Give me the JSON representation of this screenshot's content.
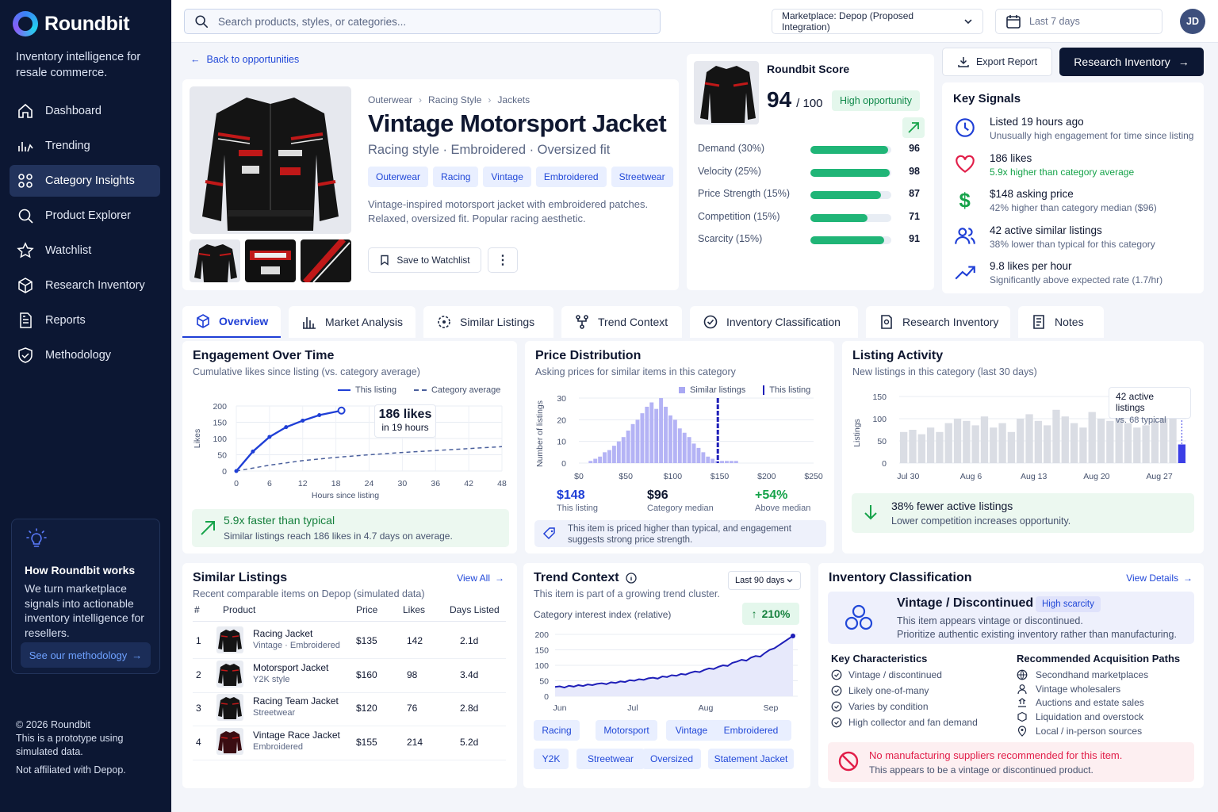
{
  "app": {
    "name": "Roundbit",
    "tagline": "Inventory intelligence for resale commerce."
  },
  "nav": [
    {
      "label": "Dashboard",
      "icon": "home-icon"
    },
    {
      "label": "Trending",
      "icon": "trending-icon"
    },
    {
      "label": "Category Insights",
      "icon": "category-icon",
      "active": true
    },
    {
      "label": "Product Explorer",
      "icon": "search-icon"
    },
    {
      "label": "Watchlist",
      "icon": "star-icon"
    },
    {
      "label": "Research Inventory",
      "icon": "cube-icon"
    },
    {
      "label": "Reports",
      "icon": "report-icon"
    },
    {
      "label": "Methodology",
      "icon": "shield-check-icon"
    }
  ],
  "how": {
    "title": "How Roundbit works",
    "text": "We turn marketplace signals into actionable inventory intelligence for resellers.",
    "button": "See our methodology"
  },
  "footer": {
    "copyright": "© 2026 Roundbit",
    "note": "This is a prototype using simulated data.",
    "disclaimer": "Not affiliated with Depop."
  },
  "top": {
    "search_placeholder": "Search products, styles, or categories...",
    "marketplace": "Marketplace: Depop (Proposed Integration)",
    "date_range": "Last 7 days",
    "avatar": "JD"
  },
  "back": "Back to opportunities",
  "product": {
    "breadcrumbs": [
      "Outerwear",
      "Racing Style",
      "Jackets"
    ],
    "title": "Vintage Motorsport Jacket",
    "subtitle": "Racing style · Embroidered · Oversized fit",
    "tags": [
      "Outerwear",
      "Racing",
      "Vintage",
      "Embroidered",
      "Streetwear"
    ],
    "description": "Vintage-inspired motorsport jacket with embroidered patches. Relaxed, oversized fit. Popular racing aesthetic.",
    "save_label": "Save to Watchlist"
  },
  "score": {
    "title": "Roundbit Score",
    "value": "94",
    "max": "/ 100",
    "badge": "High opportunity",
    "rows": [
      {
        "label": "Demand (30%)",
        "value": 96
      },
      {
        "label": "Velocity (25%)",
        "value": 98
      },
      {
        "label": "Price Strength (15%)",
        "value": 87
      },
      {
        "label": "Competition (15%)",
        "value": 71
      },
      {
        "label": "Scarcity (15%)",
        "value": 91
      }
    ]
  },
  "actions": {
    "export": "Export Report",
    "research": "Research Inventory"
  },
  "signals": {
    "title": "Key Signals",
    "items": [
      {
        "icon": "clock-icon",
        "title": "Listed 19 hours ago",
        "detail": "Unusually high engagement for time since listing",
        "color": "#1f3fd6",
        "detail_color": "#5b6784"
      },
      {
        "icon": "heart-icon",
        "title": "186 likes",
        "detail": "5.9x higher than category average",
        "color": "#e11d48",
        "detail_color": "#16a34a"
      },
      {
        "icon": "dollar-icon",
        "title": "$148 asking price",
        "detail": "42% higher than category median ($96)",
        "color": "#16a34a",
        "detail_color": "#5b6784"
      },
      {
        "icon": "users-icon",
        "title": "42 active similar listings",
        "detail": "38% lower than typical for this category",
        "color": "#1f3fd6",
        "detail_color": "#5b6784"
      },
      {
        "icon": "trend-up-icon",
        "title": "9.8 likes per hour",
        "detail": "Significantly above expected rate (1.7/hr)",
        "color": "#1f3fd6",
        "detail_color": "#5b6784"
      }
    ]
  },
  "tabs": [
    {
      "label": "Overview",
      "icon": "cube-icon"
    },
    {
      "label": "Market Analysis",
      "icon": "bar-chart-icon"
    },
    {
      "label": "Similar Listings",
      "icon": "target-icon"
    },
    {
      "label": "Trend Context",
      "icon": "network-icon"
    },
    {
      "label": "Inventory Classification",
      "icon": "check-badge-icon"
    },
    {
      "label": "Research Inventory",
      "icon": "research-icon"
    },
    {
      "label": "Notes",
      "icon": "notes-icon"
    }
  ],
  "engagement": {
    "title": "Engagement Over Time",
    "subtitle": "Cumulative likes since listing (vs. category average)",
    "legend": [
      "This listing",
      "Category average"
    ],
    "callout_big": "186 likes",
    "callout_small": "in 19 hours",
    "xlabel": "Hours since listing",
    "ylabel": "Likes",
    "insight_title": "5.9x faster than typical",
    "insight_text": "Similar listings reach 186 likes in 4.7 days on average."
  },
  "price": {
    "title": "Price Distribution",
    "subtitle": "Asking prices for similar items in this category",
    "legend": [
      "Similar listings",
      "This listing"
    ],
    "ylabel": "Number of listings",
    "stats": [
      {
        "value": "$148",
        "label": "This listing",
        "color": "#1f3fd6"
      },
      {
        "value": "$96",
        "label": "Category median",
        "color": "#0f1730"
      },
      {
        "value": "+54%",
        "label": "Above median",
        "color": "#16a34a"
      }
    ],
    "note": "This item is priced higher than typical, and engagement suggests strong price strength."
  },
  "activity": {
    "title": "Listing Activity",
    "subtitle": "New listings in this category (last 30 days)",
    "ylabel": "Listings",
    "callout_big": "42 active listings",
    "callout_small": "vs. 68 typical",
    "insight_title": "38% fewer active listings",
    "insight_text": "Lower competition increases opportunity."
  },
  "similar": {
    "title": "Similar Listings",
    "subtitle": "Recent comparable items on Depop (simulated data)",
    "view_all": "View All",
    "headers": [
      "#",
      "Product",
      "Price",
      "Likes",
      "Days Listed"
    ],
    "rows": [
      {
        "n": "1",
        "name": "Racing Jacket",
        "sub": "Vintage · Embroidered",
        "price": "$135",
        "likes": "142",
        "days": "2.1d"
      },
      {
        "n": "2",
        "name": "Motorsport Jacket",
        "sub": "Y2K style",
        "price": "$160",
        "likes": "98",
        "days": "3.4d"
      },
      {
        "n": "3",
        "name": "Racing Team Jacket",
        "sub": "Streetwear",
        "price": "$120",
        "likes": "76",
        "days": "2.8d"
      },
      {
        "n": "4",
        "name": "Vintage Race Jacket",
        "sub": "Embroidered",
        "price": "$155",
        "likes": "214",
        "days": "5.2d"
      }
    ]
  },
  "trend": {
    "title": "Trend Context",
    "subtitle": "This item is part of a growing trend cluster.",
    "range": "Last 90 days",
    "metric": "Category interest index (relative)",
    "change": "210%",
    "tags": [
      "Racing",
      "Motorsport",
      "Vintage",
      "Embroidered",
      "Y2K",
      "Streetwear",
      "Oversized",
      "Statement Jacket"
    ]
  },
  "classification": {
    "title": "Inventory Classification",
    "view": "View Details",
    "heading": "Vintage / Discontinued",
    "badge": "High scarcity",
    "line1": "This item appears vintage or discontinued.",
    "line2": "Prioritize authentic existing inventory rather than manufacturing.",
    "kc_title": "Key Characteristics",
    "kc": [
      "Vintage / discontinued",
      "Likely one-of-many",
      "Varies by condition",
      "High collector and fan demand"
    ],
    "paths_title": "Recommended Acquisition Paths",
    "paths": [
      "Secondhand marketplaces",
      "Vintage wholesalers",
      "Auctions and estate sales",
      "Liquidation and overstock",
      "Local / in-person sources"
    ],
    "warn_title": "No manufacturing suppliers recommended for this item.",
    "warn_text": "This appears to be a vintage or discontinued product."
  },
  "chart_data": [
    {
      "type": "line",
      "title": "Engagement Over Time",
      "xlabel": "Hours since listing",
      "ylabel": "Likes",
      "x_ticks": [
        0,
        6,
        12,
        18,
        24,
        30,
        36,
        42,
        48
      ],
      "y_ticks": [
        0,
        50,
        100,
        150,
        200
      ],
      "ylim": [
        0,
        200
      ],
      "xlim": [
        0,
        48
      ],
      "series": [
        {
          "name": "This listing",
          "x": [
            0,
            3,
            6,
            9,
            12,
            15,
            19
          ],
          "y": [
            0,
            60,
            105,
            135,
            155,
            172,
            186
          ]
        },
        {
          "name": "Category average",
          "x": [
            0,
            6,
            12,
            18,
            24,
            30,
            36,
            42,
            48
          ],
          "y": [
            0,
            18,
            32,
            42,
            50,
            57,
            63,
            69,
            75
          ]
        }
      ],
      "legend": "top-right"
    },
    {
      "type": "bar",
      "title": "Price Distribution",
      "ylabel": "Number of listings",
      "x_ticks": [
        "$0",
        "$50",
        "$100",
        "$150",
        "$200",
        "$250"
      ],
      "y_ticks": [
        0,
        10,
        20,
        30
      ],
      "ylim": [
        0,
        30
      ],
      "bin_start": 10,
      "bin_width": 5,
      "values": [
        1,
        2,
        3,
        5,
        6,
        8,
        10,
        12,
        15,
        18,
        20,
        23,
        26,
        28,
        25,
        30,
        26,
        22,
        20,
        16,
        14,
        12,
        9,
        7,
        5,
        3,
        2,
        1,
        1,
        1,
        1,
        1
      ],
      "marker": {
        "name": "This listing",
        "x": 148
      },
      "legend": "top-right"
    },
    {
      "type": "bar",
      "title": "Listing Activity",
      "ylabel": "Listings",
      "x_ticks": [
        "Jul 30",
        "Aug 6",
        "Aug 13",
        "Aug 20",
        "Aug 27"
      ],
      "y_ticks": [
        0,
        50,
        100,
        150
      ],
      "ylim": [
        0,
        150
      ],
      "values": [
        70,
        75,
        65,
        80,
        70,
        90,
        100,
        95,
        85,
        105,
        80,
        90,
        70,
        100,
        110,
        95,
        85,
        120,
        105,
        90,
        80,
        115,
        100,
        95,
        110,
        90,
        80,
        85,
        95,
        100,
        100,
        42
      ],
      "highlight_index": 31
    },
    {
      "type": "line",
      "title": "Trend Context",
      "ylabel": "Category interest index (relative)",
      "x_ticks": [
        "Jun",
        "Jul",
        "Aug",
        "Sep"
      ],
      "y_ticks": [
        0,
        50,
        100,
        150,
        200
      ],
      "ylim": [
        0,
        200
      ],
      "values": [
        30,
        32,
        28,
        34,
        31,
        36,
        33,
        38,
        36,
        40,
        42,
        39,
        45,
        43,
        48,
        46,
        52,
        50,
        55,
        53,
        58,
        60,
        57,
        64,
        62,
        68,
        66,
        72,
        70,
        76,
        80,
        78,
        85,
        90,
        88,
        95,
        100,
        98,
        108,
        112,
        118,
        115,
        125,
        130,
        128,
        140,
        150,
        155,
        165,
        175,
        185,
        195
      ],
      "area": true
    }
  ]
}
